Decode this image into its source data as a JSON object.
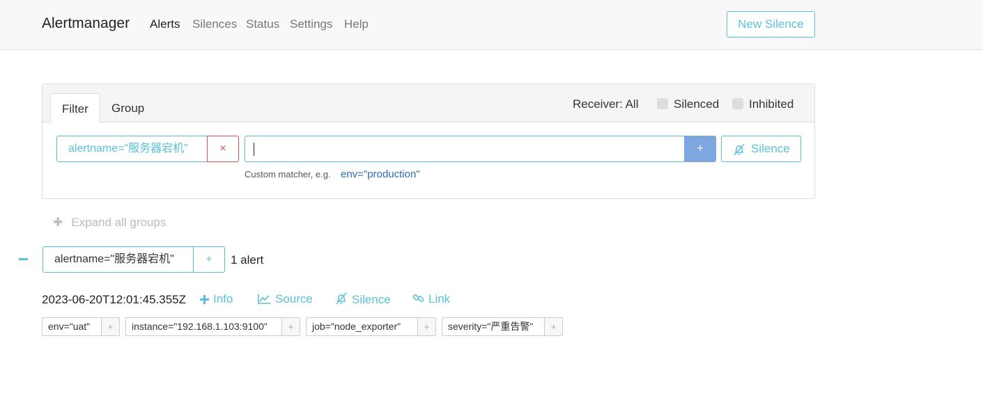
{
  "nav": {
    "brand": "Alertmanager",
    "items": [
      "Alerts",
      "Silences",
      "Status",
      "Settings",
      "Help"
    ],
    "new_silence": "New Silence"
  },
  "filter": {
    "tabs": [
      "Filter",
      "Group"
    ],
    "receiver": "Receiver: All",
    "silenced_label": "Silenced",
    "inhibited_label": "Inhibited",
    "matcher": "alertname=\"服务器宕机\"",
    "remove_symbol": "×",
    "input_value": "",
    "add_symbol": "+",
    "silence_label": "Silence",
    "hint_text": "Custom matcher, e.g.",
    "hint_example": "env=\"production\""
  },
  "expand_all": "Expand all groups",
  "group": {
    "matcher": "alertname=\"服务器宕机\"",
    "add_symbol": "+",
    "count": "1 alert"
  },
  "alert": {
    "timestamp": "2023-06-20T12:01:45.355Z",
    "actions": [
      "Info",
      "Source",
      "Silence",
      "Link"
    ],
    "labels": [
      "env=\"uat\"",
      "instance=\"192.168.1.103:9100\"",
      "job=\"node_exporter\"",
      "severity=\"严重告警\""
    ]
  },
  "colors": {
    "accent": "#5bc0de",
    "danger": "#d9534f",
    "primary_btn": "#7ea7e0"
  }
}
